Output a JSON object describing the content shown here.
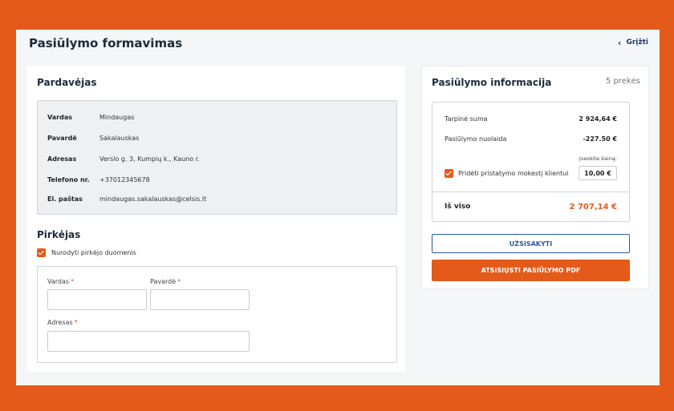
{
  "header": {
    "title": "Pasiūlymo formavimas",
    "back_label": "Grįžti"
  },
  "seller": {
    "title": "Pardavėjas",
    "rows": [
      {
        "key": "Vardas",
        "value": "Mindaugas"
      },
      {
        "key": "Pavardė",
        "value": "Sakalauskas"
      },
      {
        "key": "Adresas",
        "value": "Verslo g. 3, Kumpių k., Kauno r."
      },
      {
        "key": "Telefono nr.",
        "value": "+37012345678"
      },
      {
        "key": "El. paštas",
        "value": "mindaugas.sakalauskas@celsis.lt"
      }
    ]
  },
  "buyer": {
    "title": "Pirkėjas",
    "checkbox_label": "Nurodyti pirkėjo duomenis",
    "checkbox_checked": true,
    "fields": {
      "first_name": {
        "label": "Vardas",
        "required_mark": "*",
        "value": ""
      },
      "last_name": {
        "label": "Pavardė",
        "required_mark": "*",
        "value": ""
      },
      "address": {
        "label": "Adresas",
        "required_mark": "*",
        "value": ""
      }
    }
  },
  "offer": {
    "title": "Pasiūlymo informacija",
    "items_count": "5 prekės",
    "subtotal_label": "Tarpinė suma",
    "subtotal_value": "2 924,64 €",
    "discount_label": "Pasiūlymo nuolaida",
    "discount_value": "-227.50 €",
    "enter_price_label": "Įveskite kainą:",
    "delivery_label": "Pridėti pristatymo mokestį klientui",
    "delivery_checked": true,
    "delivery_price": "10,00 €",
    "total_label": "Iš viso",
    "total_value": "2 707,14 €",
    "order_button": "UŽSISAKYTI",
    "download_button": "ATSISIŲSTI PASIŪLYMO PDF"
  },
  "colors": {
    "accent": "#e35a1a",
    "link": "#2c5aa0",
    "background": "#f5f6f8"
  }
}
